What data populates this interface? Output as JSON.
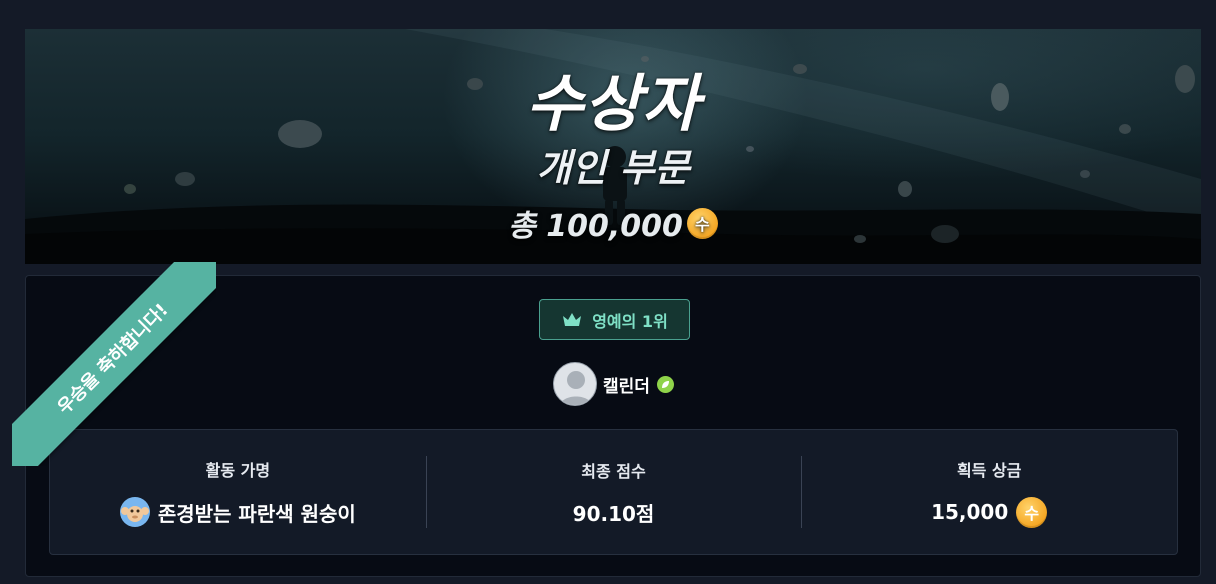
{
  "banner": {
    "title": "수상자",
    "subtitle": "개인 부문",
    "prize_prefix": "총 100,000",
    "coin_symbol": "수"
  },
  "ribbon": {
    "text": "우승을 축하합니다!"
  },
  "badge": {
    "label": "영예의 1위",
    "icon": "crown-icon"
  },
  "user": {
    "name": "캘린더",
    "level_icon": "leaf-level-icon"
  },
  "stats": [
    {
      "label": "활동 가명",
      "value": "존경받는 파란색 원숭이",
      "icon": "monkey-icon"
    },
    {
      "label": "최종 점수",
      "value": "90.10점"
    },
    {
      "label": "획득 상금",
      "value": "15,000",
      "icon": "coin-icon"
    }
  ],
  "colors": {
    "accent_teal": "#56b3a2",
    "badge_text": "#7fe0c6",
    "coin": "#f5a623",
    "background": "#141a27",
    "card": "#070b14"
  }
}
